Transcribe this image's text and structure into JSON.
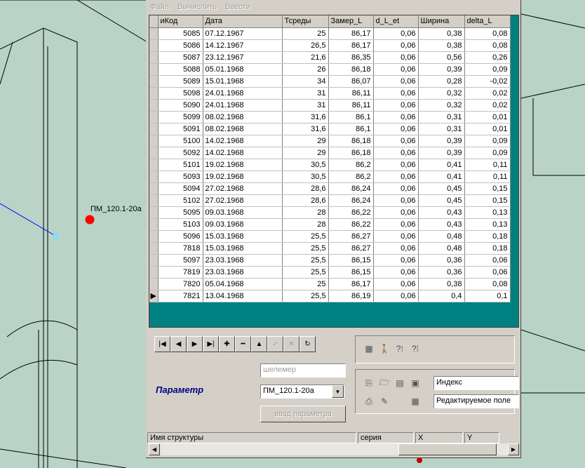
{
  "map": {
    "point_label": "ПМ_120.1-20а"
  },
  "menu": [
    "Файл",
    "Вычислить",
    "Ввести"
  ],
  "grid": {
    "columns": [
      "иКод",
      "Дата",
      "Тсреды",
      "Замер_L",
      "d_L_et",
      "Ширина",
      "delta_L"
    ],
    "rows": [
      [
        "5085",
        "07.12.1967",
        "25",
        "86,17",
        "0,06",
        "0,38",
        "0,08"
      ],
      [
        "5086",
        "14.12.1967",
        "26,5",
        "86,17",
        "0,06",
        "0,38",
        "0,08"
      ],
      [
        "5087",
        "23.12.1967",
        "21,6",
        "86,35",
        "0,06",
        "0,56",
        "0,26"
      ],
      [
        "5088",
        "05.01.1968",
        "26",
        "86,18",
        "0,06",
        "0,39",
        "0,09"
      ],
      [
        "5089",
        "15.01.1968",
        "34",
        "86,07",
        "0,06",
        "0,28",
        "-0,02"
      ],
      [
        "5098",
        "24.01.1968",
        "31",
        "86,11",
        "0,06",
        "0,32",
        "0,02"
      ],
      [
        "5090",
        "24.01.1968",
        "31",
        "86,11",
        "0,06",
        "0,32",
        "0,02"
      ],
      [
        "5099",
        "08.02.1968",
        "31,6",
        "86,1",
        "0,06",
        "0,31",
        "0,01"
      ],
      [
        "5091",
        "08.02.1968",
        "31,6",
        "86,1",
        "0,06",
        "0,31",
        "0,01"
      ],
      [
        "5100",
        "14.02.1968",
        "29",
        "86,18",
        "0,06",
        "0,39",
        "0,09"
      ],
      [
        "5092",
        "14.02.1968",
        "29",
        "86,18",
        "0,06",
        "0,39",
        "0,09"
      ],
      [
        "5101",
        "19.02.1968",
        "30,5",
        "86,2",
        "0,06",
        "0,41",
        "0,11"
      ],
      [
        "5093",
        "19.02.1968",
        "30,5",
        "86,2",
        "0,06",
        "0,41",
        "0,11"
      ],
      [
        "5094",
        "27.02.1968",
        "28,6",
        "86,24",
        "0,06",
        "0,45",
        "0,15"
      ],
      [
        "5102",
        "27.02.1968",
        "28,6",
        "86,24",
        "0,06",
        "0,45",
        "0,15"
      ],
      [
        "5095",
        "09.03.1968",
        "28",
        "86,22",
        "0,06",
        "0,43",
        "0,13"
      ],
      [
        "5103",
        "09.03.1968",
        "28",
        "86,22",
        "0,06",
        "0,43",
        "0,13"
      ],
      [
        "5096",
        "15.03.1968",
        "25,5",
        "86,27",
        "0,06",
        "0,48",
        "0,18"
      ],
      [
        "7818",
        "15.03.1968",
        "25,5",
        "86,27",
        "0,06",
        "0,48",
        "0,18"
      ],
      [
        "5097",
        "23.03.1968",
        "25,5",
        "86,15",
        "0,06",
        "0,36",
        "0,06"
      ],
      [
        "7819",
        "23.03.1968",
        "25,5",
        "86,15",
        "0,06",
        "0,36",
        "0,06"
      ],
      [
        "7820",
        "05.04.1968",
        "25",
        "86,17",
        "0,06",
        "0,38",
        "0,08"
      ],
      [
        "7821",
        "13.04.1968",
        "25,5",
        "86,19",
        "0,06",
        "0,4",
        "0,1"
      ]
    ],
    "current_row": 22
  },
  "navigator": [
    {
      "name": "first-record-button",
      "glyph": "|◀",
      "enabled": true
    },
    {
      "name": "prior-record-button",
      "glyph": "◀",
      "enabled": true
    },
    {
      "name": "next-record-button",
      "glyph": "▶",
      "enabled": true
    },
    {
      "name": "last-record-button",
      "glyph": "▶|",
      "enabled": true
    },
    {
      "name": "insert-record-button",
      "glyph": "✚",
      "enabled": true
    },
    {
      "name": "delete-record-button",
      "glyph": "━",
      "enabled": true
    },
    {
      "name": "edit-record-button",
      "glyph": "▲",
      "enabled": true
    },
    {
      "name": "post-record-button",
      "glyph": "✓",
      "enabled": false
    },
    {
      "name": "cancel-record-button",
      "glyph": "✕",
      "enabled": false
    },
    {
      "name": "refresh-button",
      "glyph": "↻",
      "enabled": true
    }
  ],
  "param": {
    "label": "Параметр",
    "type_placeholder": "шелемер",
    "selected": "ПМ_120.1-20а",
    "enter_button": "ввод параметра"
  },
  "right_panel": {
    "index_value": "Индекс",
    "edit_field_value": "Редактируемое поле"
  },
  "status": {
    "structure_name": "Имя структуры",
    "series": "серия",
    "x": "X",
    "y": "Y"
  }
}
